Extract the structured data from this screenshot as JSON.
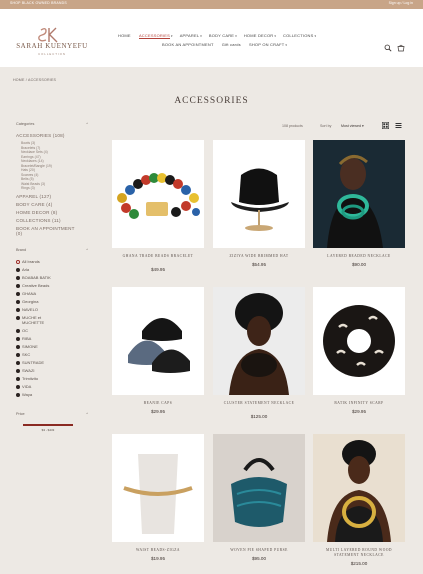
{
  "topbar": {
    "left": "SHOP BLACK OWNED BRANDS",
    "right": "Sign up / Log in"
  },
  "logo": {
    "name": "SARAH KUENYEFU",
    "tagline": "COLLECTION",
    "mark": "SK"
  },
  "nav": {
    "row1": [
      "HOME",
      "ACCESSORIES",
      "APPAREL",
      "BODY CARE",
      "HOME DECOR",
      "COLLECTIONS"
    ],
    "row2": [
      "BOOK AN APPOINTMENT",
      "Gift cards",
      "SHOP ON CRAFT"
    ],
    "active": "ACCESSORIES"
  },
  "header_icons": [
    "search-icon",
    "cart-icon"
  ],
  "breadcrumb": "HOME  /  ACCESSORIES",
  "page_title": "ACCESSORIES",
  "toolbar": {
    "count": "108 products",
    "sort_label": "Sort by",
    "sort_value": "Most viewed"
  },
  "sidebar": {
    "categories_heading": "Categories",
    "categories": [
      {
        "label": "ACCESSORIES (108)",
        "subs": [
          "Bowls (3)",
          "Bracelets (7)",
          "Necklace Sets (4)",
          "Earrings (47)",
          "Necklaces (14)",
          "Bracelet/Bangle (19)",
          "Hats (20)",
          "Scarves (4)",
          "Belts (5)",
          "Waist Beads (3)",
          "Rings (3)"
        ]
      },
      {
        "label": "APPAREL (127)"
      },
      {
        "label": "BODY CARE (4)"
      },
      {
        "label": "HOME DECOR (8)"
      },
      {
        "label": "COLLECTIONS (11)"
      },
      {
        "label": "BOOK AN APPOINTMENT (0)"
      }
    ],
    "brand_heading": "Brand",
    "brands": [
      "All brands",
      "Arla",
      "BOABAB BATIK",
      "Creative Beads",
      "GHANA",
      "Georgina",
      "NAVELO",
      "MUCHE et MUCHETTE",
      "OC",
      "RIBA",
      "SIMONE",
      "SKC",
      "SUNTRADE",
      "SWAZI",
      "Trimitzito",
      "VIDA",
      "Waya"
    ],
    "price_heading": "Price",
    "price_range": "$3 - $433"
  },
  "products": [
    {
      "title": "GHANA TRADE BEADS BRACELET",
      "price": "$49.95"
    },
    {
      "title": "ZIZIYA WIDE BRIMMED HAT",
      "price": "$54.95"
    },
    {
      "title": "LAYERED BEADED NECKLACE",
      "price": "$90.00"
    },
    {
      "title": "BEANIE CAPS",
      "price": "$29.95"
    },
    {
      "title": "CLUSTER STATEMENT NECKLACE",
      "price": "$125.00"
    },
    {
      "title": "BATIK INFINITY SCARF",
      "price": "$29.95"
    },
    {
      "title": "WAIST BEADS-ZIGZA",
      "price": "$19.95"
    },
    {
      "title": "WOVEN PIE SHAPED PURSE",
      "price": "$95.00"
    },
    {
      "title": "MULTI LAYERED ROUND WOOD STATEMENT NECKLACE",
      "price": "$215.00"
    }
  ],
  "colors": {
    "accent": "#9b2a22",
    "topbar": "#c8a588",
    "page_bg": "#ede9e4"
  }
}
